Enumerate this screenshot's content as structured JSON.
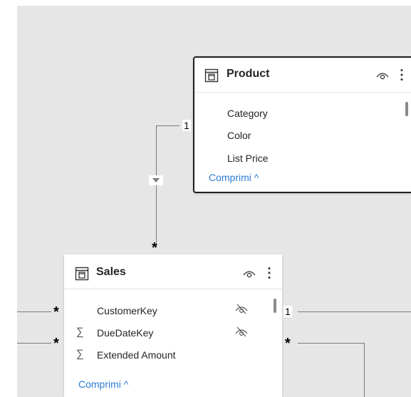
{
  "product": {
    "title": "Product",
    "fields": [
      "Category",
      "Color",
      "List Price"
    ],
    "collapse_label": "Comprimi ^"
  },
  "sales": {
    "title": "Sales",
    "fields": [
      {
        "name": "CustomerKey",
        "hidden": true,
        "summarizable": false
      },
      {
        "name": "DueDateKey",
        "hidden": true,
        "summarizable": true
      },
      {
        "name": "Extended Amount",
        "hidden": false,
        "summarizable": true
      }
    ],
    "collapse_label": "Comprimi ^"
  },
  "relationships": {
    "product_sales_one": "1",
    "product_sales_many": "*",
    "left_top_many": "*",
    "left_mid_many": "*",
    "right_top_one": "1",
    "right_mid_many": "*"
  },
  "colors": {
    "canvas": "#e6e6e6",
    "link": "#2b7bd3",
    "line": "#7a7a7a",
    "selected_border": "#1f1f1f"
  },
  "icons": {
    "table": "table-icon",
    "visibility": "eye-icon",
    "menu": "more-vertical-icon",
    "hidden": "eye-slash-icon",
    "filter": "filter-direction-icon"
  }
}
